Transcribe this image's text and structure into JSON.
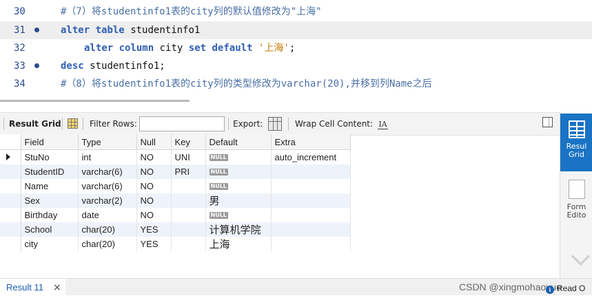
{
  "editor": {
    "lines": [
      {
        "number": "30",
        "text": "#（7）将studentinfo1表的city列的默认值修改为\"上海\""
      },
      {
        "number": "31",
        "kw1": "alter",
        "kw2": "table",
        "text": "studentinfo1"
      },
      {
        "number": "32",
        "kw1": "alter",
        "kw2": "column",
        "ident": "city",
        "kw3": "set",
        "kw4": "default",
        "str": "'上海'",
        "end": ";"
      },
      {
        "number": "33",
        "kw1": "desc",
        "text": "studentinfo1;"
      },
      {
        "number": "34",
        "text": "#（8）将studentinfo1表的city列的类型修改为varchar(20),并移到列Name之后"
      }
    ]
  },
  "toolbar": {
    "result_grid": "Result Grid",
    "filter_rows": "Filter Rows:",
    "export": "Export:",
    "wrap": "Wrap Cell Content:",
    "wrap_icon": "IA"
  },
  "grid": {
    "columns": [
      "Field",
      "Type",
      "Null",
      "Key",
      "Default",
      "Extra"
    ],
    "null_badge": "NULL",
    "rows": [
      {
        "field": "StuNo",
        "type": "int",
        "null": "NO",
        "key": "UNI",
        "default": "NULL",
        "extra": "auto_increment"
      },
      {
        "field": "StudentID",
        "type": "varchar(6)",
        "null": "NO",
        "key": "PRI",
        "default": "NULL",
        "extra": ""
      },
      {
        "field": "Name",
        "type": "varchar(6)",
        "null": "NO",
        "key": "",
        "default": "NULL",
        "extra": ""
      },
      {
        "field": "Sex",
        "type": "varchar(2)",
        "null": "NO",
        "key": "",
        "default": "男",
        "extra": ""
      },
      {
        "field": "Birthday",
        "type": "date",
        "null": "NO",
        "key": "",
        "default": "NULL",
        "extra": ""
      },
      {
        "field": "School",
        "type": "char(20)",
        "null": "YES",
        "key": "",
        "default": "计算机学院",
        "extra": ""
      },
      {
        "field": "city",
        "type": "char(20)",
        "null": "YES",
        "key": "",
        "default": "上海",
        "extra": ""
      }
    ]
  },
  "sidepanel": {
    "result_grid_label_1": "Resul",
    "result_grid_label_2": "Grid",
    "form_editor_label_1": "Form",
    "form_editor_label_2": "Edito"
  },
  "bottom": {
    "tab_label": "Result 11",
    "close": "×",
    "watermark": "CSDN @xingmohaoyue",
    "read_only": "Read O",
    "info": "i"
  }
}
